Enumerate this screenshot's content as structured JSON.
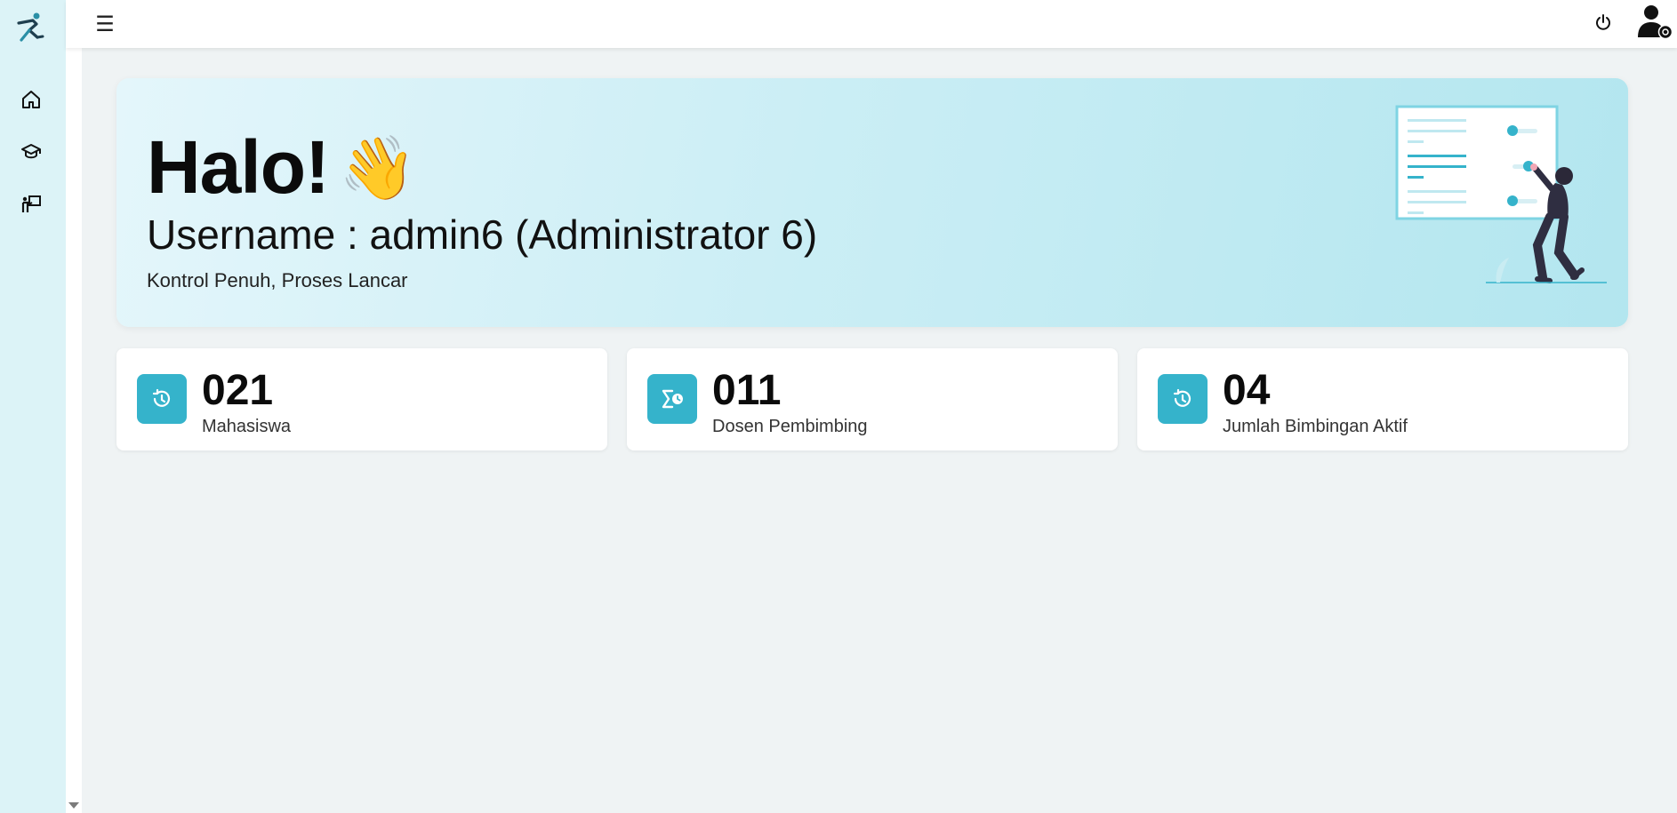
{
  "sidebar": {
    "logo": "runner-logo-icon",
    "items": [
      {
        "icon": "home-icon"
      },
      {
        "icon": "graduation-cap-icon"
      },
      {
        "icon": "teacher-board-icon"
      }
    ]
  },
  "topbar": {
    "menu_glyph": "☰",
    "power_icon": "power-icon",
    "avatar_icon": "user-settings-icon"
  },
  "hero": {
    "title": "Halo!",
    "wave_emoji": "👋",
    "username_line": "Username : admin6 (Administrator 6)",
    "subtitle": "Kontrol Penuh, Proses Lancar"
  },
  "stats": [
    {
      "value": "021",
      "label": "Mahasiswa",
      "icon": "clock-refresh-icon"
    },
    {
      "value": "011",
      "label": "Dosen Pembimbing",
      "icon": "sigma-clock-icon"
    },
    {
      "value": "04",
      "label": "Jumlah Bimbingan Aktif",
      "icon": "clock-refresh-icon"
    }
  ],
  "colors": {
    "sidebar_bg": "#dcf3f7",
    "accent": "#35b3cb",
    "page_bg": "#eff3f4"
  }
}
